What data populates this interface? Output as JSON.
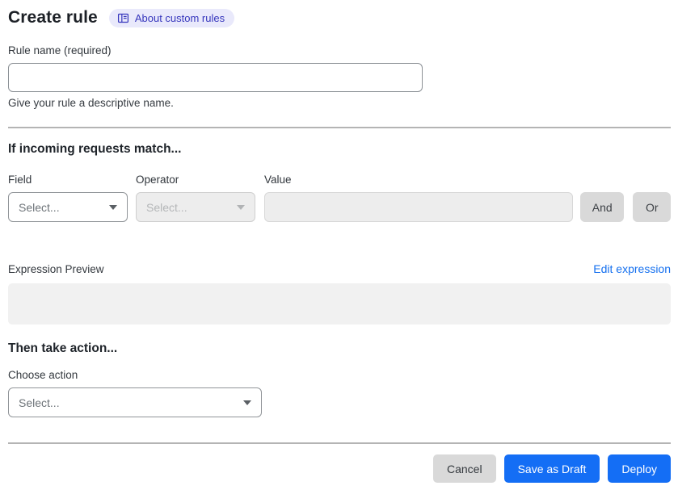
{
  "header": {
    "title": "Create rule",
    "about_link": {
      "label": "About custom rules",
      "icon": "book-icon"
    }
  },
  "rule_name": {
    "label": "Rule name (required)",
    "value": "",
    "helper": "Give your rule a descriptive name."
  },
  "match_section": {
    "heading": "If incoming requests match...",
    "field": {
      "label": "Field",
      "selected": "Select...",
      "enabled": true,
      "icon": "chevron-down-icon"
    },
    "operator": {
      "label": "Operator",
      "selected": "Select...",
      "enabled": false,
      "icon": "chevron-down-icon"
    },
    "value": {
      "label": "Value",
      "value": "",
      "enabled": false
    },
    "and_button": "And",
    "or_button": "Or"
  },
  "expression": {
    "label": "Expression Preview",
    "edit_link": "Edit expression",
    "preview_content": ""
  },
  "action_section": {
    "heading": "Then take action...",
    "choose_label": "Choose action",
    "selected": "Select...",
    "icon": "chevron-down-icon"
  },
  "footer": {
    "cancel": "Cancel",
    "save_draft": "Save as Draft",
    "deploy": "Deploy"
  },
  "colors": {
    "primary_blue": "#146ef5",
    "link_blue": "#1570ef",
    "badge_bg": "#e9e9fb",
    "badge_text": "#3737bd",
    "gray_button_bg": "#d9d9d9",
    "disabled_bg": "#ededed",
    "preview_bg": "#f1f1f1",
    "divider": "#b4b4b4"
  }
}
